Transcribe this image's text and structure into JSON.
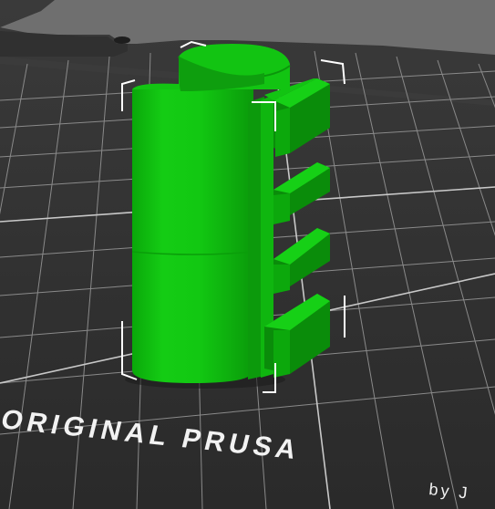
{
  "viewport": {
    "bed_brand_text": "ORIGINAL PRUSA",
    "bed_byline_text": "by J",
    "object_color": "#10d010",
    "selection_box_color": "#ffffff",
    "bed_color": "#2e2e2e",
    "grid_color": "#8a8a8a",
    "background_color": "#6e6e6e"
  }
}
